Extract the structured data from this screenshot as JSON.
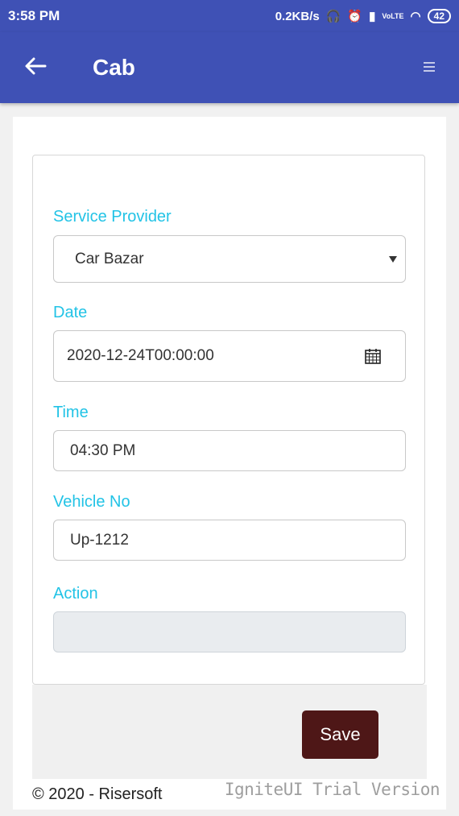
{
  "status_bar": {
    "time": "3:58 PM",
    "net_speed": "0.2KB/s",
    "battery": "42",
    "volte": "VoLTE"
  },
  "app_bar": {
    "title": "Cab",
    "back_icon": "arrow-left-icon",
    "menu_icon": "hamburger-icon"
  },
  "form": {
    "service_provider": {
      "label": "Service Provider",
      "value": "Car Bazar"
    },
    "date": {
      "label": "Date",
      "value": "2020-12-24T00:00:00"
    },
    "time": {
      "label": "Time",
      "value": "04:30 PM"
    },
    "vehicle_no": {
      "label": "Vehicle No",
      "value": "Up-1212"
    },
    "action": {
      "label": "Action",
      "value": ""
    }
  },
  "save_label": "Save",
  "footer": {
    "copyright": "© 2020 - Risersoft",
    "watermark": "IgniteUI Trial Version"
  },
  "colors": {
    "primary": "#3f51b5",
    "label": "#22c3e6",
    "save_button": "#4e1717"
  }
}
